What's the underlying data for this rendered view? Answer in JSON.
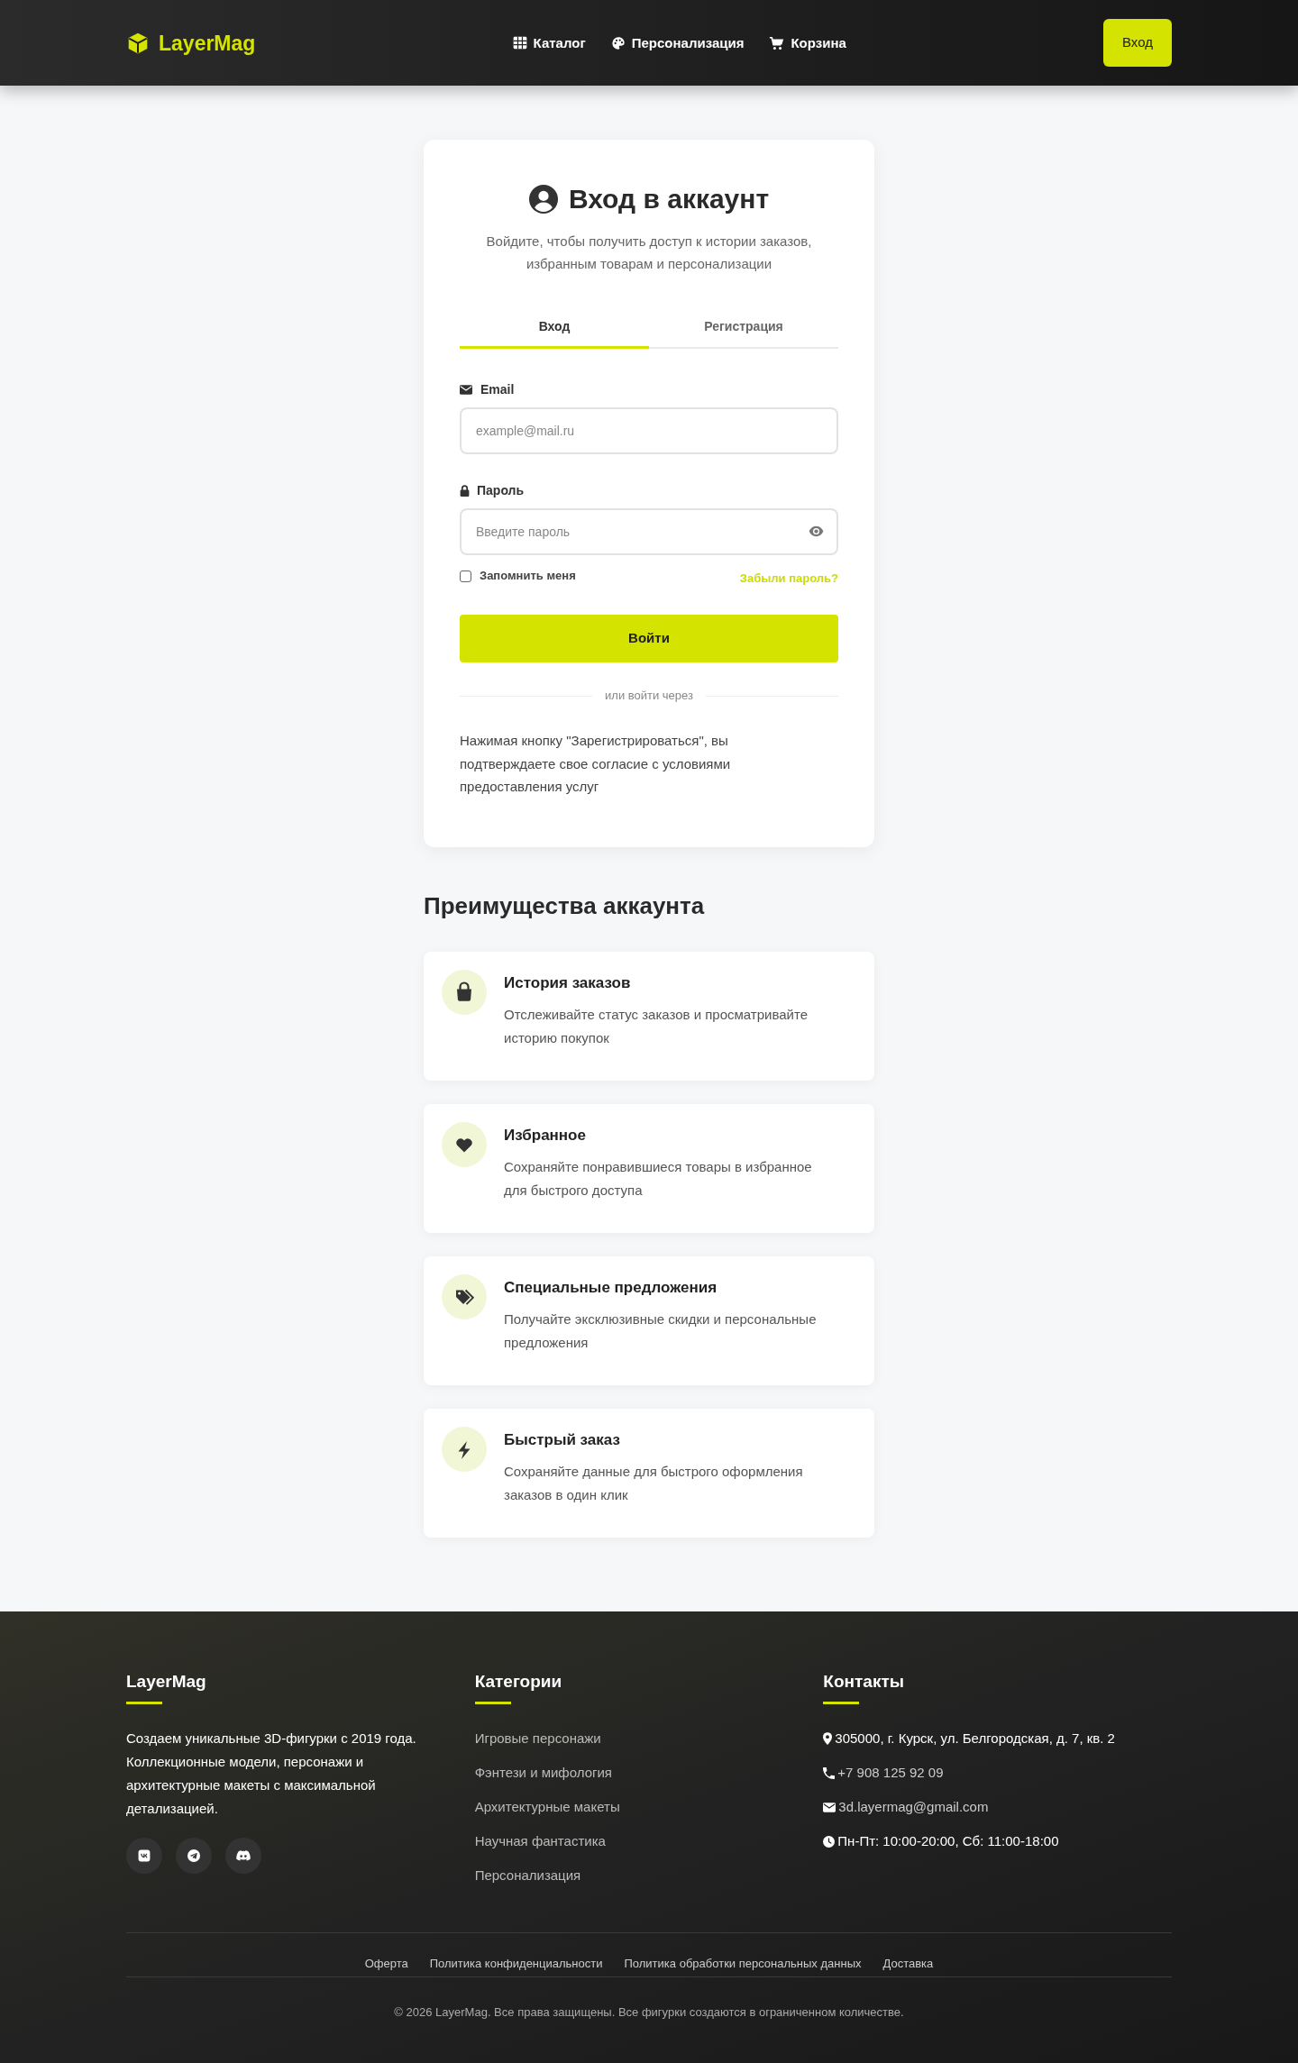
{
  "header": {
    "logo": "LayerMag",
    "nav": [
      "Каталог",
      "Персонализация",
      "Корзина"
    ],
    "login_button": "Вход"
  },
  "login_card": {
    "title": "Вход в аккаунт",
    "subtitle": "Войдите, чтобы получить доступ к истории заказов, избранным товарам и персонализации",
    "tabs": [
      {
        "label": "Вход",
        "selected": true
      },
      {
        "label": "Регистрация",
        "selected": false
      }
    ],
    "email": {
      "label": "Email",
      "placeholder": "example@mail.ru"
    },
    "password": {
      "label": "Пароль",
      "placeholder": "Введите пароль"
    },
    "remember_me": {
      "label": "Запомнить меня",
      "checked": false
    },
    "forgot_password": "Забыли пароль?",
    "submit_button": "Войти",
    "divider": "или войти через",
    "terms": "Нажимая кнопку \"Зарегистрироваться\", вы подтверждаете свое согласие с условиями предоставления услуг"
  },
  "benefits": {
    "title": "Преимущества аккаунта",
    "items": [
      {
        "title": "История заказов",
        "description": "Отслеживайте статус заказов и просматривайте историю покупок"
      },
      {
        "title": "Избранное",
        "description": "Сохраняйте понравившиеся товары в избранное для быстрого доступа"
      },
      {
        "title": "Специальные предложения",
        "description": "Получайте эксклюзивные скидки и персональные предложения"
      },
      {
        "title": "Быстрый заказ",
        "description": "Сохраняйте данные для быстрого оформления заказов в один клик"
      }
    ]
  },
  "footer": {
    "about": {
      "title": "LayerMag",
      "text": "Создаем уникальные 3D-фигурки с 2019 года. Коллекционные модели, персонажи и архитектурные макеты с максимальной детализацией."
    },
    "categories": {
      "title": "Категории",
      "links": [
        "Игровые персонажи",
        "Фэнтези и мифология",
        "Архитектурные макеты",
        "Научная фантастика",
        "Персонализация"
      ]
    },
    "contacts": {
      "title": "Контакты",
      "items": [
        {
          "text": "305000, г. Курск, ул. Белгородская, д. 7, кв. 2",
          "kind": "text"
        },
        {
          "text": "+7 908 125 92 09",
          "kind": "link"
        },
        {
          "text": "3d.layermag@gmail.com",
          "kind": "link"
        },
        {
          "text": "Пн-Пт: 10:00-20:00, Сб: 11:00-18:00",
          "kind": "text"
        }
      ]
    },
    "legal_links": [
      "Оферта",
      "Политика конфиденциальности",
      "Политика обработки персональных данных",
      "Доставка"
    ],
    "copyright": "© 2026 LayerMag. Все права защищены. Все фигурки создаются в ограниченном количестве."
  }
}
